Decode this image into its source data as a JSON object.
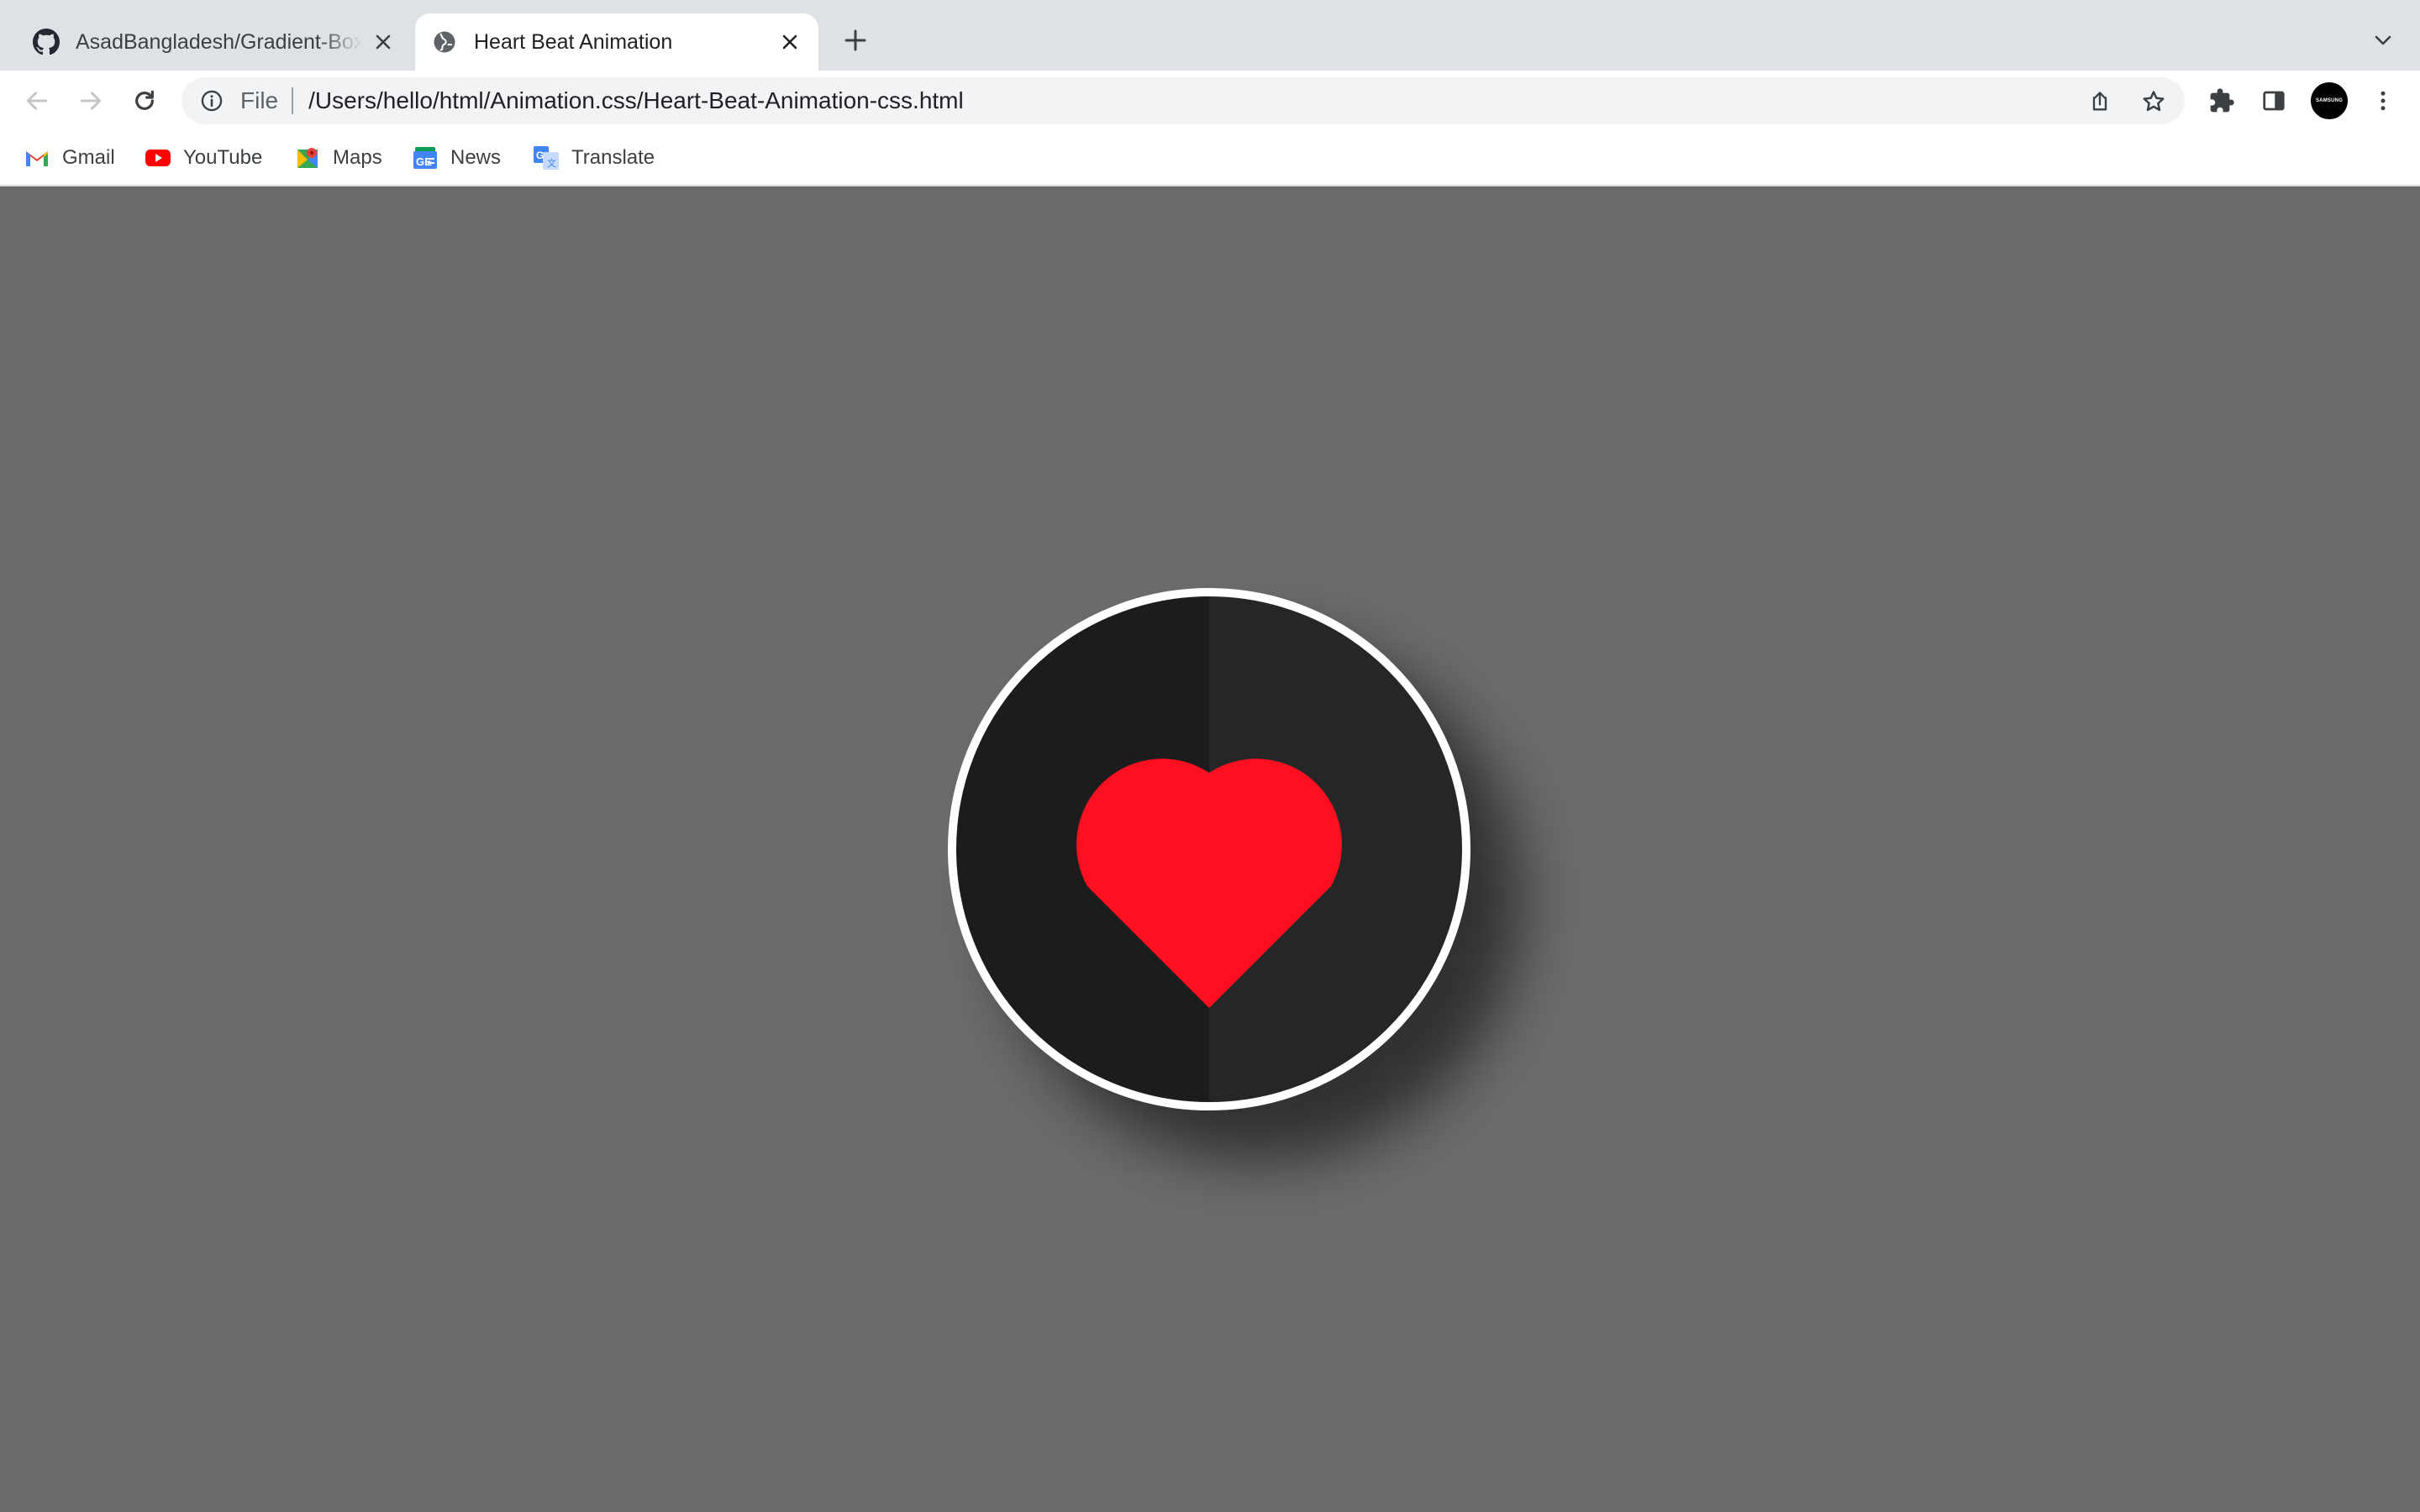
{
  "browser": {
    "tabs": [
      {
        "title": "AsadBangladesh/Gradient-Box",
        "favicon": "github-icon",
        "active": false
      },
      {
        "title": "Heart Beat Animation",
        "favicon": "globe-icon",
        "active": true
      }
    ],
    "new_tab_icon": "plus-icon",
    "tab_search_icon": "chevron-down-icon"
  },
  "toolbar": {
    "back_icon": "arrow-left-icon",
    "forward_icon": "arrow-right-icon",
    "reload_icon": "reload-icon",
    "omnibox": {
      "info_icon": "info-icon",
      "scheme_label": "File",
      "url": "/Users/hello/html/Animation.css/Heart-Beat-Animation-css.html",
      "share_icon": "share-icon",
      "bookmark_icon": "star-icon"
    },
    "extensions_icon": "puzzle-icon",
    "side_panel_icon": "side-panel-icon",
    "profile_label": "SAMSUNG",
    "menu_icon": "kebab-menu-icon"
  },
  "bookmarks": [
    {
      "label": "Gmail",
      "icon": "gmail-icon"
    },
    {
      "label": "YouTube",
      "icon": "youtube-icon"
    },
    {
      "label": "Maps",
      "icon": "maps-icon"
    },
    {
      "label": "News",
      "icon": "news-icon"
    },
    {
      "label": "Translate",
      "icon": "translate-icon"
    }
  ],
  "page": {
    "background_color": "#6b6b6b",
    "circle_left_color": "#1c1c1d",
    "circle_right_color": "#262627",
    "circle_border_color": "#ffffff",
    "heart_color": "#ff0f1f"
  }
}
